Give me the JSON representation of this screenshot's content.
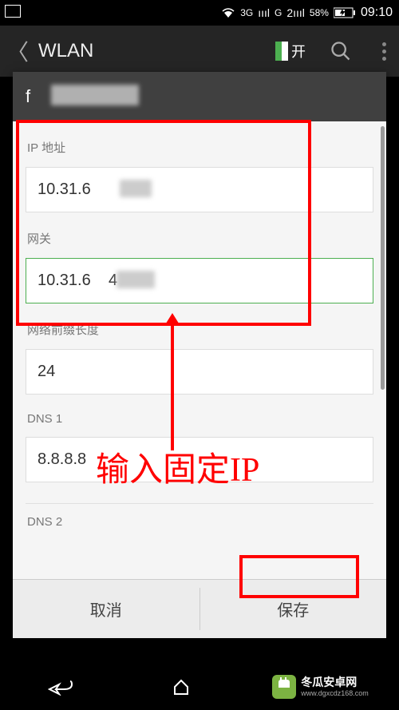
{
  "statusbar": {
    "network1": "3G",
    "network2": "G",
    "signal1": "ıııl",
    "signal2": "2ıııl",
    "battery": "58%",
    "time": "09:10"
  },
  "appbar": {
    "title": "WLAN",
    "toggle": "开"
  },
  "dialog": {
    "title_prefix": "f",
    "fields": {
      "ip_label": "IP 地址",
      "ip_value": "10.31.6",
      "gateway_label": "网关",
      "gateway_value": "10.31.6    4",
      "prefix_label": "网络前缀长度",
      "prefix_value": "24",
      "dns1_label": "DNS 1",
      "dns1_value": "8.8.8.8",
      "dns2_label": "DNS 2"
    },
    "footer": {
      "cancel": "取消",
      "save": "保存"
    }
  },
  "annotation": {
    "text": "输入固定IP"
  },
  "brand": {
    "name": "冬瓜安卓网",
    "url": "www.dgxcdz168.com"
  }
}
